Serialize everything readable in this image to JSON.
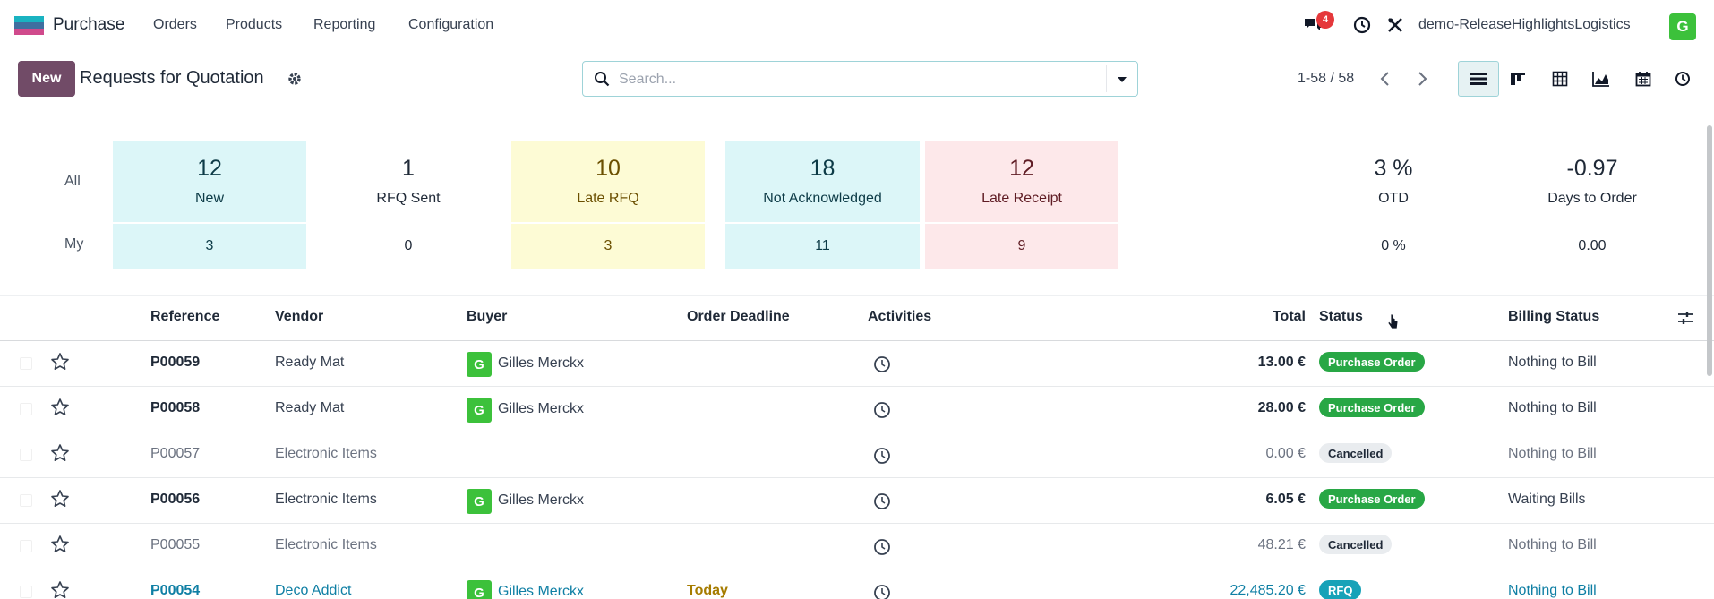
{
  "app": {
    "name": "Purchase"
  },
  "menu": [
    {
      "label": "Orders"
    },
    {
      "label": "Products"
    },
    {
      "label": "Reporting"
    },
    {
      "label": "Configuration"
    }
  ],
  "systray": {
    "message_count": "4",
    "company": "demo-ReleaseHighlightsLogistics",
    "user_initial": "G"
  },
  "control": {
    "new_label": "New",
    "title": "Requests for Quotation",
    "search_placeholder": "Search...",
    "pager": "1-58 / 58"
  },
  "dashboard": {
    "all_label": "All",
    "my_label": "My",
    "tiles": [
      {
        "value": "12",
        "label": "New",
        "my": "3"
      },
      {
        "value": "1",
        "label": "RFQ Sent",
        "my": "0"
      },
      {
        "value": "10",
        "label": "Late RFQ",
        "my": "3"
      },
      {
        "value": "18",
        "label": "Not Acknowledged",
        "my": "11"
      },
      {
        "value": "12",
        "label": "Late Receipt",
        "my": "9"
      },
      {
        "value": "3 %",
        "label": "OTD",
        "my": "0 %"
      },
      {
        "value": "-0.97",
        "label": "Days to Order",
        "my": "0.00"
      }
    ]
  },
  "table": {
    "headers": {
      "reference": "Reference",
      "vendor": "Vendor",
      "buyer": "Buyer",
      "deadline": "Order Deadline",
      "activities": "Activities",
      "total": "Total",
      "status": "Status",
      "billing": "Billing Status"
    },
    "rows": [
      {
        "reference": "P00059",
        "vendor": "Ready Mat",
        "buyer": "Gilles Merckx",
        "buyer_initial": "G",
        "deadline": "",
        "total": "13.00 €",
        "status": "Purchase Order",
        "billing": "Nothing to Bill"
      },
      {
        "reference": "P00058",
        "vendor": "Ready Mat",
        "buyer": "Gilles Merckx",
        "buyer_initial": "G",
        "deadline": "",
        "total": "28.00 €",
        "status": "Purchase Order",
        "billing": "Nothing to Bill"
      },
      {
        "reference": "P00057",
        "vendor": "Electronic Items",
        "buyer": "",
        "buyer_initial": "",
        "deadline": "",
        "total": "0.00 €",
        "status": "Cancelled",
        "billing": "Nothing to Bill"
      },
      {
        "reference": "P00056",
        "vendor": "Electronic Items",
        "buyer": "Gilles Merckx",
        "buyer_initial": "G",
        "deadline": "",
        "total": "6.05 €",
        "status": "Purchase Order",
        "billing": "Waiting Bills"
      },
      {
        "reference": "P00055",
        "vendor": "Electronic Items",
        "buyer": "",
        "buyer_initial": "",
        "deadline": "",
        "total": "48.21 €",
        "status": "Cancelled",
        "billing": "Nothing to Bill"
      },
      {
        "reference": "P00054",
        "vendor": "Deco Addict",
        "buyer": "Gilles Merckx",
        "buyer_initial": "G",
        "deadline": "Today",
        "total": "22,485.20 €",
        "status": "RFQ",
        "billing": "Nothing to Bill"
      }
    ]
  }
}
